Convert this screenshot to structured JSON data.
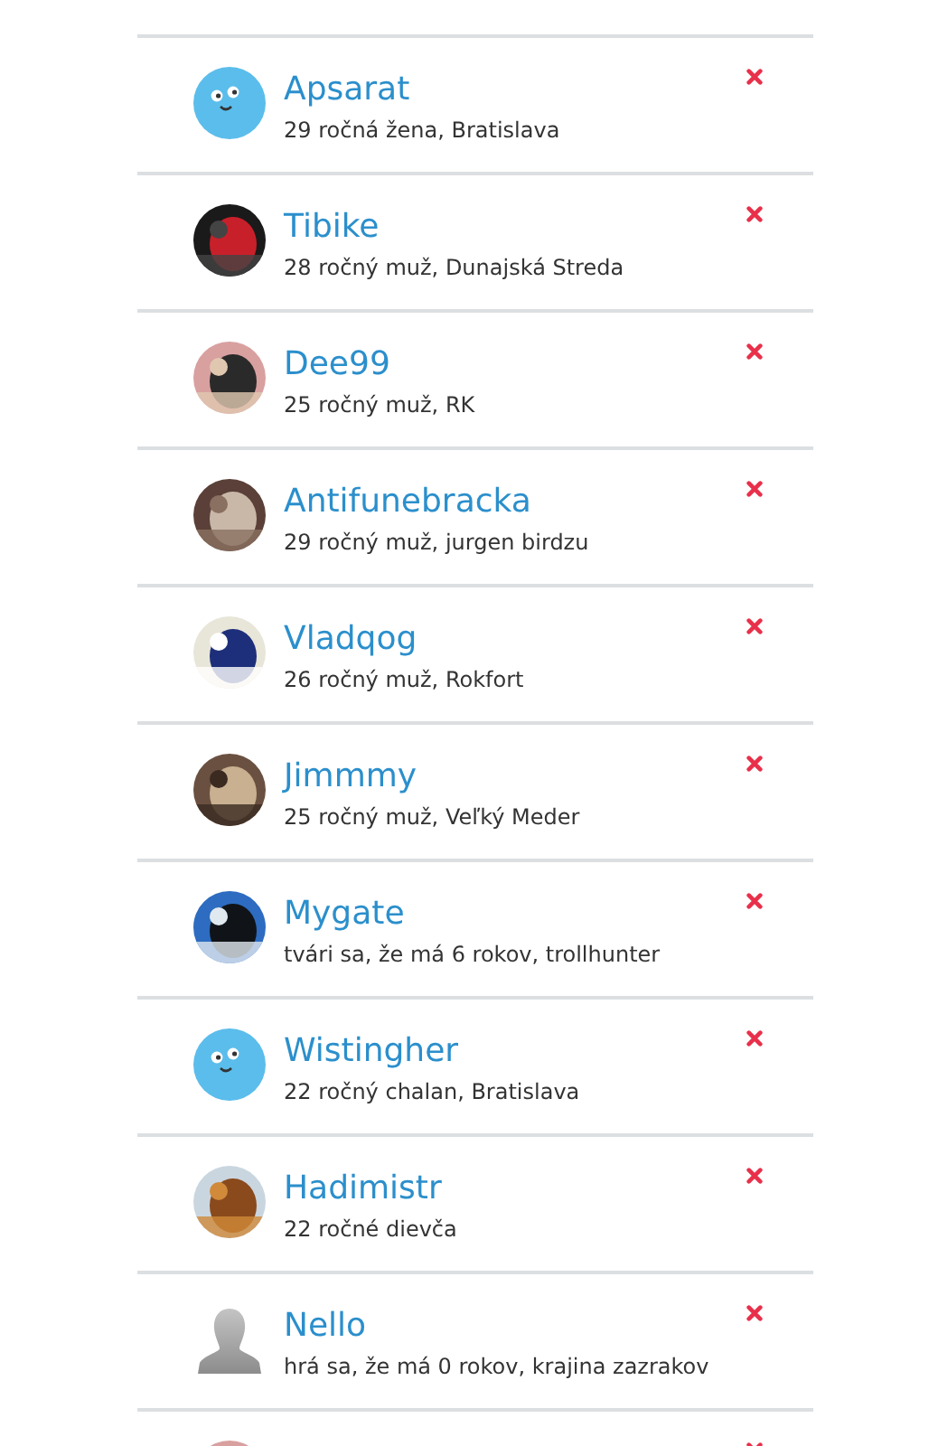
{
  "users": [
    {
      "name": "Apsarat",
      "info": "29 ročná žena, Bratislava",
      "avatar": {
        "kind": "smiley"
      }
    },
    {
      "name": "Tibike",
      "info": "28 ročný muž, Dunajská Streda",
      "avatar": {
        "kind": "picture"
      }
    },
    {
      "name": "Dee99",
      "info": "25 ročný muž, RK",
      "avatar": {
        "kind": "picture"
      }
    },
    {
      "name": "Antifunebracka",
      "info": "29 ročný muž, jurgen birdzu",
      "avatar": {
        "kind": "picture"
      }
    },
    {
      "name": "Vladqog",
      "info": "26 ročný muž, Rokfort",
      "avatar": {
        "kind": "picture"
      }
    },
    {
      "name": "Jimmmy",
      "info": "25 ročný muž, Veľký Meder",
      "avatar": {
        "kind": "picture"
      }
    },
    {
      "name": "Mygate",
      "info": "tvári sa, že má 6 rokov, trollhunter",
      "avatar": {
        "kind": "picture"
      }
    },
    {
      "name": "Wistingher",
      "info": "22 ročný chalan, Bratislava",
      "avatar": {
        "kind": "smiley"
      }
    },
    {
      "name": "Hadimistr",
      "info": "22 ročné dievča",
      "avatar": {
        "kind": "picture"
      }
    },
    {
      "name": "Nello",
      "info": "hrá sa, že má 0 rokov, krajina zazrakov",
      "avatar": {
        "kind": "silhouette"
      }
    },
    {
      "avatar": {
        "kind": "picture"
      }
    }
  ]
}
